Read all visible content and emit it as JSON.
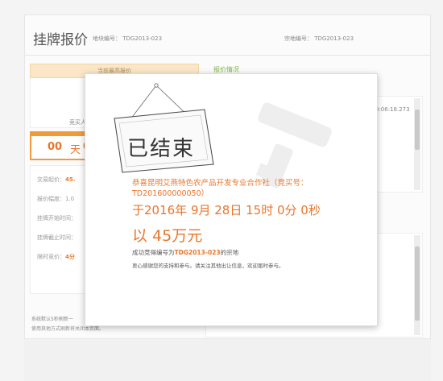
{
  "header": {
    "title": "挂牌报价",
    "plot_label": "地块编号：",
    "plot_code": "TDG2013-023",
    "zong_label": "宗地编号：",
    "zong_code": "TDG2013-023"
  },
  "left": {
    "max_bid_label": "当前最高报价",
    "bidder_label": "竞买人",
    "countdown": {
      "days": "00",
      "day_unit": "天",
      "rest": "0"
    },
    "info_rows": [
      {
        "label": "交易起价：",
        "value": "45.",
        "highlight": true
      },
      {
        "label": "报价幅度：",
        "value": "1.0",
        "highlight": false
      },
      {
        "label": "挂牌开始时间：",
        "value": "",
        "highlight": false
      },
      {
        "label": "挂牌截止时间：",
        "value": "",
        "highlight": false
      },
      {
        "label": "限时竞价：",
        "value": "4分",
        "highlight": true
      }
    ],
    "hint_line1": "系统默认5秒刷新一",
    "hint_line2": "使用其他方式刷新将关闭本页面。"
  },
  "right": {
    "panel_title": "报价情况",
    "timestamp": "0:06:18.273",
    "colon": ":"
  },
  "modal": {
    "sign_text": "已结束",
    "winner": "恭喜昆明艾燕特色农产品开发专业合作社（竞买号：TD201600000050）",
    "date": "于2016年 9月 28日 15时 0分 0秒",
    "price": "以 45万元",
    "success_prefix": "成功竞得编号为",
    "success_code": "TDG2013-023",
    "success_suffix": "的宗地",
    "thanks": "衷心感谢您的支持和参与。请关注其他出让信息，欢迎届时参与。"
  },
  "colors": {
    "accent": "#e8762c",
    "green": "#7fb54a",
    "hammer": "#eeeeee"
  }
}
